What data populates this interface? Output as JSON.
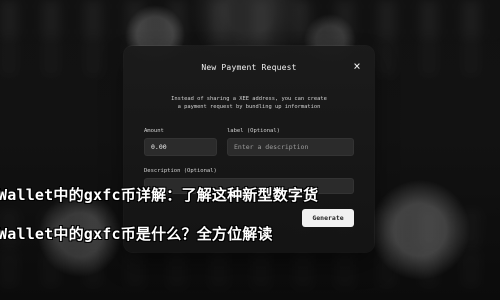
{
  "modal": {
    "title": "New Payment Request",
    "close_label": "×",
    "description_lines": [
      "Instead of sharing a XEE address, you can create",
      "a payment request by bundling up information"
    ]
  },
  "form": {
    "amount_label": "Amount",
    "amount_value": "0.00",
    "label_label": "label (Optional)",
    "label_placeholder": "Enter a description",
    "description_label": "Description (Optional)",
    "description_placeholder": "",
    "generate_label": "Generate"
  },
  "overlay": {
    "line1": "Wallet中的gxfc币详解：了解这种新型数字货",
    "line2": "Wallet中的gxfc币是什么？全方位解读"
  },
  "colors": {
    "background": "#101010",
    "panel": "#1b1b1b",
    "input": "#2b2b2b",
    "button": "#f1f1f1"
  }
}
